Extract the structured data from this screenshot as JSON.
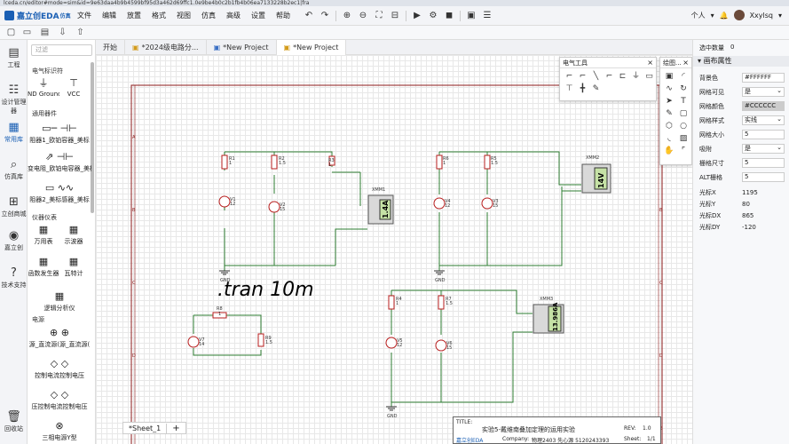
{
  "browser": {
    "url": "lceda.cn/editor#mode=sim&id=9e63daa4b9b4599bf95d3a462d69ffc1.0e9be4b0c2b1fb4b06ea7133228b2ec1|fra"
  },
  "app": {
    "logo": "嘉立创EDA",
    "logo_badge": "仿真",
    "menu": [
      "文件",
      "编辑",
      "放置",
      "格式",
      "视图",
      "仿真",
      "高级",
      "设置",
      "帮助"
    ],
    "user": {
      "mode": "个人",
      "name": "Xxylsq"
    }
  },
  "left_rail": [
    {
      "label": "工程",
      "icon": "folder-icon"
    },
    {
      "label": "设计管理器",
      "icon": "tree-icon"
    },
    {
      "label": "常用库",
      "icon": "chip-icon"
    },
    {
      "label": "仿真库",
      "icon": "search-icon"
    },
    {
      "label": "立创商城",
      "icon": "shop-icon"
    },
    {
      "label": "嘉立创",
      "icon": "jlc-icon"
    },
    {
      "label": "技术支持",
      "icon": "help-icon"
    },
    {
      "label": "回收站",
      "icon": "trash-icon"
    }
  ],
  "library": {
    "search_placeholder": "过滤",
    "sections": {
      "elec": "电气标识符",
      "common": "通用器件",
      "instr": "仪器仪表",
      "power": "电源"
    },
    "items": {
      "gnd": "ND Ground",
      "vcc": "VCC",
      "res": "阻器1_欧铂容器_美标",
      "var": "变电阻_欧铂电容器_美标",
      "ind": "阻器2_美标感器_美标",
      "meter": "万用表",
      "osc": "示波器",
      "fgen": "函数发生器",
      "watt": "瓦特计",
      "logic": "逻辑分析仪",
      "src1": "源_直流源(源_直流源(",
      "src2": "控制电流控制电压",
      "src3": "压控制电流控制电压",
      "src4": "三相电源Y型"
    }
  },
  "tabs": [
    {
      "label": "开始"
    },
    {
      "label": "*2024级电路分..."
    },
    {
      "label": "*New Project"
    },
    {
      "label": "*New Project"
    }
  ],
  "canvas": {
    "directive": ".tran 10m",
    "sheet_tab": "*Sheet_1",
    "add_sheet": "+",
    "border_rows": [
      "A",
      "B",
      "C",
      "D",
      "E"
    ],
    "labels": {
      "r1": "R1",
      "r1v": "1",
      "r2": "R2",
      "r2v": "1.5",
      "r3": "R3",
      "r3v": "1",
      "v1": "V1",
      "v1v": "12",
      "v2": "V2",
      "v2v": "15",
      "xmm1": "XMM1",
      "xmm1_read": "1.4A",
      "r6": "R6",
      "r6v": "1",
      "r5": "R5",
      "r5v": "1.5",
      "v4": "V4",
      "v4v": "12",
      "v3b": "V3",
      "v3bv": "15",
      "xmm2": "XMM2",
      "xmm2_read": "14V",
      "r4": "R4",
      "r4v": "1",
      "r7": "R7",
      "r7v": "1.5",
      "v5": "V5",
      "v5v": "12",
      "v6": "V6",
      "v6v": "15",
      "xmm3": "XMM3",
      "xmm3_read": "13.986A",
      "r8": "R8",
      "r8v": "1",
      "r9": "R9",
      "r9v": "1.5",
      "v7": "V7",
      "v7v": "14",
      "gnd": "GND"
    },
    "title_block": {
      "title_label": "TITLE:",
      "title": "实验5-戴维南叠加定理的运用实验",
      "rev_label": "REV:",
      "rev": "1.0",
      "company_label": "Company:",
      "company": "物理2403 先心源 5120243393",
      "sheet_label": "Sheet:",
      "sheet": "1/1",
      "brand": "嘉立创EDA"
    }
  },
  "panels": {
    "elec_tools": {
      "title": "电气工具",
      "close": "×"
    },
    "draw_tools": {
      "title": "绘图...",
      "close": "×"
    }
  },
  "properties": {
    "selected_label": "选中数量",
    "selected_count": "0",
    "header": "画布属性",
    "rows": [
      {
        "k": "背景色",
        "v": "#FFFFFF"
      },
      {
        "k": "网格可见",
        "v": "是"
      },
      {
        "k": "网格颜色",
        "v": "#CCCCCC"
      },
      {
        "k": "网格样式",
        "v": "实线"
      },
      {
        "k": "网格大小",
        "v": "5"
      },
      {
        "k": "吸附",
        "v": "是"
      },
      {
        "k": "栅格尺寸",
        "v": "5"
      },
      {
        "k": "ALT栅格",
        "v": "5"
      }
    ],
    "readonly": [
      {
        "k": "光标X",
        "v": "1195"
      },
      {
        "k": "光标Y",
        "v": "80"
      },
      {
        "k": "光标DX",
        "v": "865"
      },
      {
        "k": "光标DY",
        "v": "-120"
      }
    ]
  },
  "colors": {
    "accent": "#1a5fb4",
    "wire": "#2e7d32",
    "component": "#b71c1c",
    "meter_screen": "#c5e1a5"
  }
}
